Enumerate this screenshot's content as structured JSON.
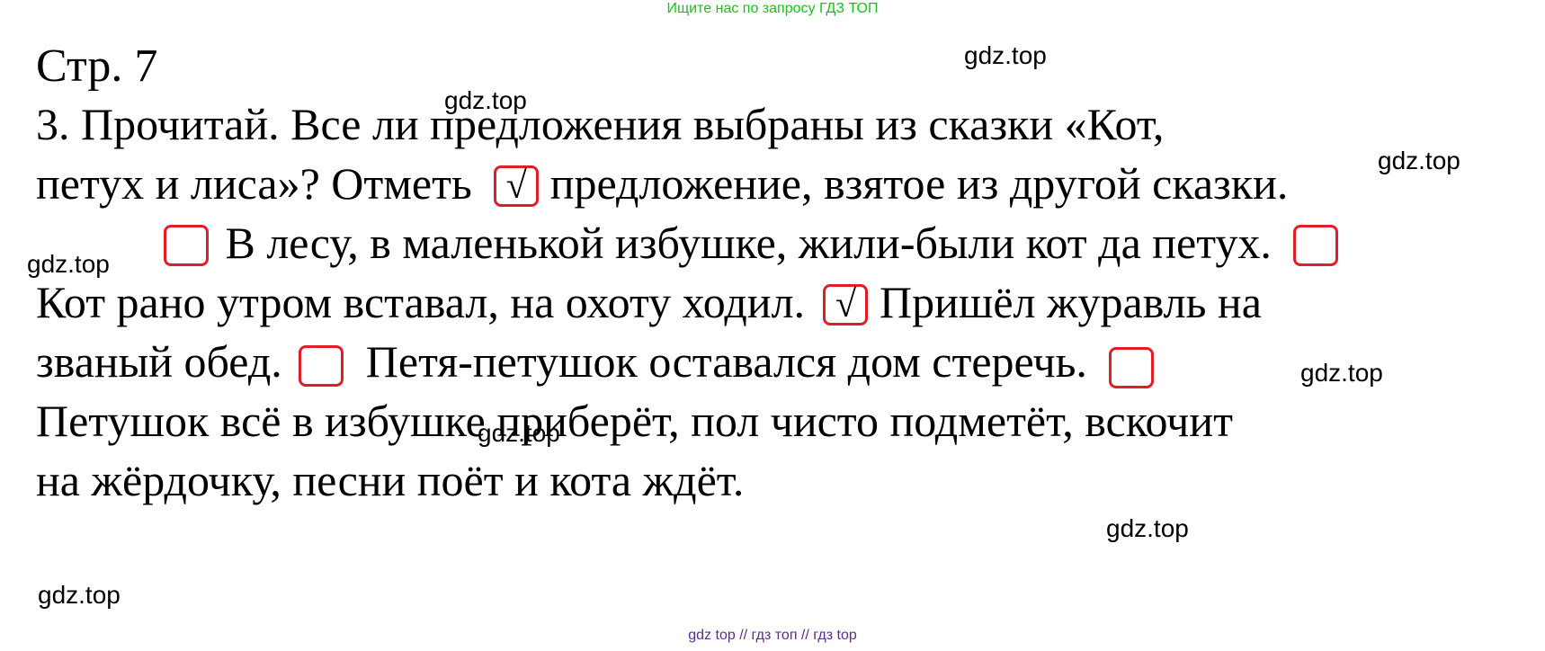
{
  "banner": {
    "top_text": "Ищите нас по запросу ГДЗ ТОП"
  },
  "page_number": "Стр. 7",
  "task": {
    "l1": "3. Прочитай. Все ли предложения выбраны из сказки «Кот,",
    "l2a": "петух и лиса»? Отметь",
    "l2b": "предложение, взятое из другой сказки.",
    "l3": "В лесу, в маленькой избушке, жили-были кот да петух.",
    "l4a": "Кот рано утром вставал, на охоту ходил.",
    "l4b": "Пришёл журавль на",
    "l5a": "званый обед.",
    "l5b": "Петя-петушок оставался дом стеречь.",
    "l6": "Петушок всё в избушке приберёт, пол чисто подметёт, вскочит",
    "l7": "на жёрдочку, песни поёт и кота ждёт."
  },
  "checkmark": "√",
  "colors": {
    "box_border": "#e01e25",
    "top_banner": "#19c219",
    "bottom_banner": "#5a2e8c"
  },
  "watermarks": {
    "w1": "gdz.top",
    "w2": "gdz.top",
    "w3": "gdz.top",
    "w4": "gdz.top",
    "w5": "gdz.top",
    "w6": "gdz.top",
    "w7": "gdz.top",
    "w8": "gdz.top"
  },
  "footer": {
    "text": "gdz top  //  гдз топ  //  гдз top"
  }
}
